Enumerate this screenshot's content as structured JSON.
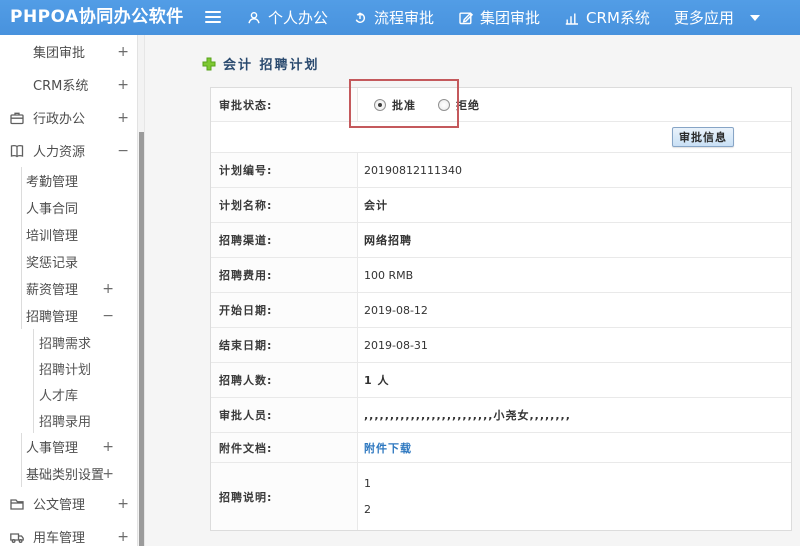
{
  "topbar": {
    "logo": "PHPOA协同办公软件",
    "nav": [
      {
        "label": "个人办公",
        "icon": "user-icon"
      },
      {
        "label": "流程审批",
        "icon": "flow-icon"
      },
      {
        "label": "集团审批",
        "icon": "edit-icon"
      },
      {
        "label": "CRM系统",
        "icon": "chart-icon"
      },
      {
        "label": "更多应用",
        "icon": "caret-down-icon"
      }
    ]
  },
  "sidebar": {
    "items": [
      {
        "label": "集团审批",
        "icon": "edit-icon",
        "toggle": "+",
        "level": 0
      },
      {
        "label": "CRM系统",
        "icon": "chart-icon",
        "toggle": "+",
        "level": 0
      },
      {
        "label": "行政办公",
        "icon": "briefcase-icon",
        "toggle": "+",
        "level": 0
      },
      {
        "label": "人力资源",
        "icon": "book-icon",
        "toggle": "−",
        "level": 0
      },
      {
        "label": "考勤管理",
        "level": 1
      },
      {
        "label": "人事合同",
        "level": 1
      },
      {
        "label": "培训管理",
        "level": 1
      },
      {
        "label": "奖惩记录",
        "level": 1
      },
      {
        "label": "薪资管理",
        "toggle": "+",
        "level": 1
      },
      {
        "label": "招聘管理",
        "toggle": "−",
        "level": 1
      },
      {
        "label": "招聘需求",
        "level": 2
      },
      {
        "label": "招聘计划",
        "level": 2
      },
      {
        "label": "人才库",
        "level": 2
      },
      {
        "label": "招聘录用",
        "level": 2
      },
      {
        "label": "人事管理",
        "toggle": "+",
        "level": 1
      },
      {
        "label": "基础类别设置",
        "toggle": "+",
        "level": 1
      },
      {
        "label": "公文管理",
        "icon": "doc-icon",
        "toggle": "+",
        "level": 0
      },
      {
        "label": "用车管理",
        "icon": "car-icon",
        "toggle": "+",
        "level": 0
      }
    ]
  },
  "main": {
    "title": "会计 招聘计划",
    "title_icon": "plus-icon",
    "approval": {
      "label": "审批状态:",
      "options": [
        {
          "label": "批准",
          "checked": true
        },
        {
          "label": "拒绝",
          "checked": false
        }
      ]
    },
    "button_label": "审批信息",
    "fields": [
      {
        "name": "plan-no",
        "label": "计划编号:",
        "value": "20190812111340"
      },
      {
        "name": "plan-name",
        "label": "计划名称:",
        "value": "会计",
        "bold": true
      },
      {
        "name": "channel",
        "label": "招聘渠道:",
        "value": "网络招聘",
        "bold": true
      },
      {
        "name": "fee",
        "label": "招聘费用:",
        "value": "100 RMB"
      },
      {
        "name": "start-date",
        "label": "开始日期:",
        "value": "2019-08-12"
      },
      {
        "name": "end-date",
        "label": "结束日期:",
        "value": "2019-08-31"
      },
      {
        "name": "headcount",
        "label": "招聘人数:",
        "value": "1 人",
        "bold": true
      },
      {
        "name": "approvers",
        "label": "审批人员:",
        "value": ",,,,,,,,,,,,,,,,,,,,,,,,,小尧女,,,,,,,,",
        "bold": true
      },
      {
        "name": "attachment",
        "label": "附件文档:",
        "value": "附件下载",
        "kind": "link"
      },
      {
        "name": "description",
        "label": "招聘说明:",
        "kind": "multiline",
        "lines": [
          "1",
          "2"
        ]
      }
    ]
  },
  "colors": {
    "topbar_bg": "#4a96e0",
    "link": "#2e78c0",
    "annotation_box": "#c4595c",
    "button_bg": "#cfe3f6",
    "title_text": "#29496e",
    "plus_icon_green": "#7ec832"
  }
}
